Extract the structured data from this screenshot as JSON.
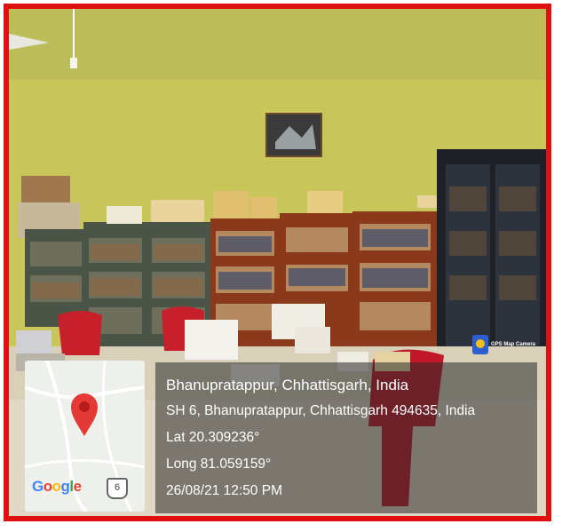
{
  "location": {
    "place": "Bhanupratappur, Chhattisgarh, India",
    "address": "SH 6, Bhanupratappur, Chhattisgarh 494635, India",
    "latitude": "Lat 20.309236°",
    "longitude": "Long 81.059159°",
    "datetime": "26/08/21 12:50 PM"
  },
  "map": {
    "brand": "Google",
    "route_number": "6",
    "pin_color": "#e53935"
  },
  "camera_app": {
    "label": "GPS Map Camera"
  },
  "colors": {
    "border": "#e01010",
    "wall": "#c9c860"
  }
}
